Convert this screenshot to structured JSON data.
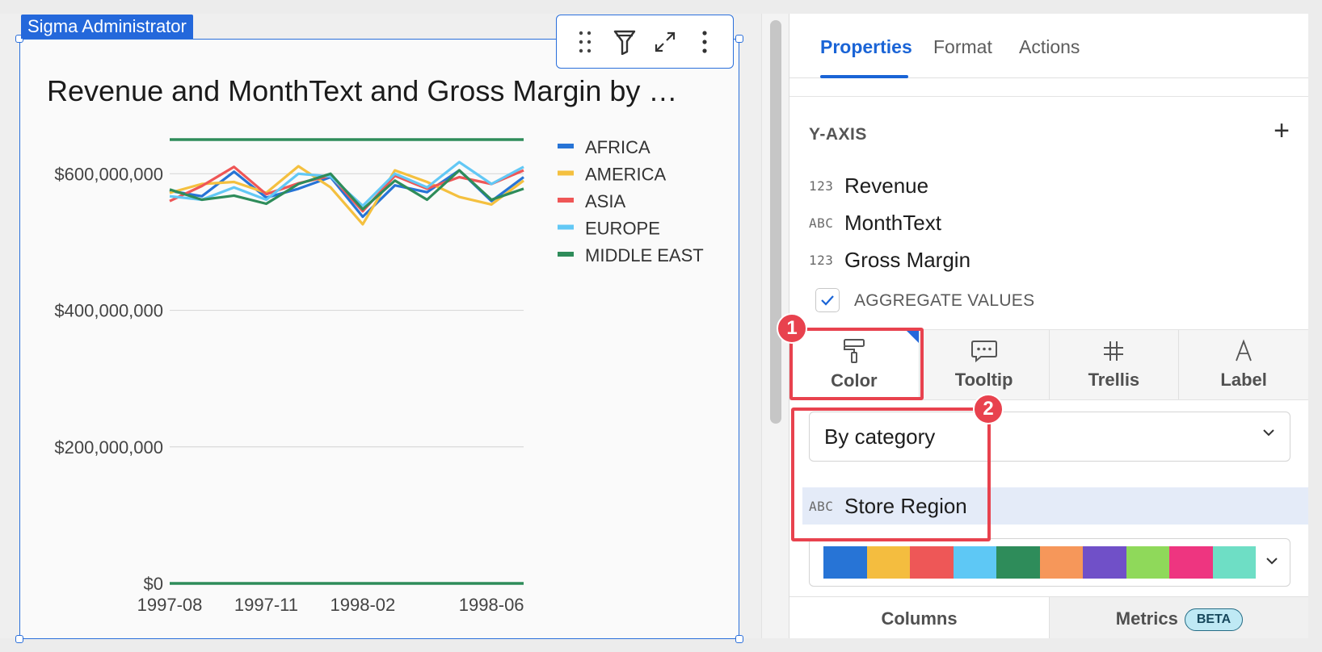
{
  "workbook": {
    "owner_tag": "Sigma Administrator",
    "chart_title": "Revenue and MonthText and Gross Margin by …"
  },
  "chart_data": {
    "type": "line",
    "x": [
      "1997-08",
      "1997-09",
      "1997-10",
      "1997-11",
      "1997-12",
      "1998-01",
      "1998-02",
      "1998-03",
      "1998-04",
      "1998-05",
      "1998-06",
      "1998-07"
    ],
    "x_tick_labels": [
      "1997-08",
      "1997-11",
      "1998-02",
      "1998-06"
    ],
    "y_tick_labels": [
      "$600,000,000",
      "$400,000,000",
      "$200,000,000",
      "$0"
    ],
    "y_ticks": [
      600000000,
      400000000,
      200000000,
      0
    ],
    "ylim": [
      0,
      650000000
    ],
    "grid": true,
    "legend_position": "right",
    "series": [
      {
        "name": "AFRICA",
        "color": "#2774d6",
        "values": [
          575000000,
          567000000,
          603000000,
          565000000,
          578000000,
          595000000,
          537000000,
          583000000,
          573000000,
          605000000,
          560000000,
          595000000
        ]
      },
      {
        "name": "AMERICA",
        "color": "#f4c03f",
        "values": [
          572000000,
          585000000,
          588000000,
          572000000,
          611000000,
          580000000,
          526000000,
          605000000,
          588000000,
          566000000,
          555000000,
          590000000
        ]
      },
      {
        "name": "ASIA",
        "color": "#ef5656",
        "values": [
          560000000,
          582000000,
          610000000,
          570000000,
          586000000,
          597000000,
          545000000,
          597000000,
          578000000,
          595000000,
          585000000,
          605000000
        ]
      },
      {
        "name": "EUROPE",
        "color": "#62c8f5",
        "values": [
          567000000,
          562000000,
          580000000,
          562000000,
          600000000,
          596000000,
          553000000,
          600000000,
          580000000,
          617000000,
          585000000,
          610000000
        ]
      },
      {
        "name": "MIDDLE EAST",
        "color": "#2e8c5a",
        "values": [
          577000000,
          562000000,
          568000000,
          556000000,
          585000000,
          600000000,
          548000000,
          590000000,
          562000000,
          605000000,
          562000000,
          578000000
        ]
      }
    ],
    "reference_lines": [
      {
        "name": "",
        "color": "#2e8c5a",
        "value": 650000000
      },
      {
        "name": "",
        "color": "#2e8c5a",
        "value": 0
      }
    ]
  },
  "panel": {
    "tabs": [
      {
        "label": "Properties",
        "active": true
      },
      {
        "label": "Format",
        "active": false
      },
      {
        "label": "Actions",
        "active": false
      }
    ],
    "y_axis_label": "Y-AXIS",
    "y_axis_fields": [
      {
        "type": "123",
        "name": "Revenue"
      },
      {
        "type": "ABC",
        "name": "MonthText"
      },
      {
        "type": "123",
        "name": "Gross Margin"
      }
    ],
    "aggregate_label": "AGGREGATE VALUES",
    "aggregate_checked": true,
    "mark_tabs": [
      {
        "label": "Color",
        "icon": "paint-roller-icon",
        "active": true
      },
      {
        "label": "Tooltip",
        "icon": "speech-bubble-icon",
        "active": false
      },
      {
        "label": "Trellis",
        "icon": "trellis-icon",
        "active": false
      },
      {
        "label": "Label",
        "icon": "text-label-icon",
        "active": false
      }
    ],
    "color_mode": "By category",
    "color_by_field": {
      "type": "ABC",
      "name": "Store Region"
    },
    "palette": [
      "#2774d6",
      "#f4bd3f",
      "#ee5757",
      "#5ec8f5",
      "#2e8c5a",
      "#f6975a",
      "#7050c8",
      "#8fd95a",
      "#ee3580",
      "#6edec5"
    ],
    "bottom_tabs": [
      {
        "label": "Columns"
      },
      {
        "label": "Metrics",
        "badge": "BETA"
      }
    ]
  },
  "annotations": [
    {
      "number": "1"
    },
    {
      "number": "2"
    }
  ]
}
